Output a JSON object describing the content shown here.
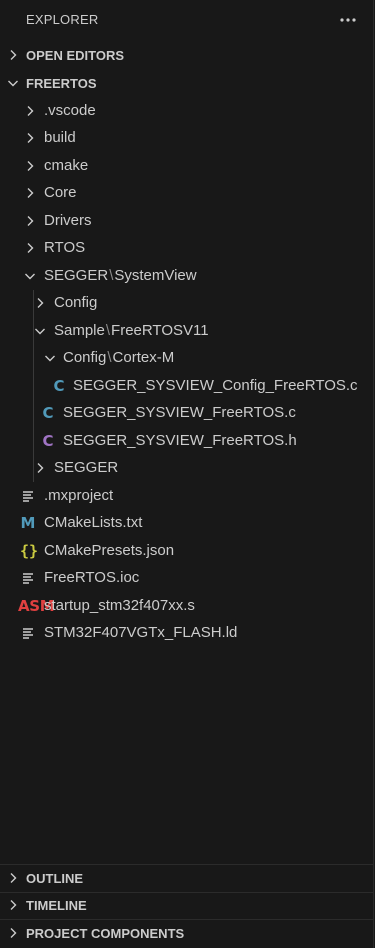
{
  "explorer": {
    "title": "EXPLORER",
    "more_label": "Views and More Actions"
  },
  "sections": {
    "open_editors": "OPEN EDITORS",
    "folder": "FREERTOS",
    "outline": "OUTLINE",
    "timeline": "TIMELINE",
    "project_components": "PROJECT COMPONENTS"
  },
  "tree": {
    "vscode": ".vscode",
    "build": "build",
    "cmake": "cmake",
    "core": "Core",
    "drivers": "Drivers",
    "rtos": "RTOS",
    "segger": "SEGGER",
    "systemview": "SystemView",
    "config": "Config",
    "sample": "Sample",
    "freertosv11": "FreeRTOSV11",
    "config2": "Config",
    "cortex_m": "Cortex-M",
    "sysview_config_c": "SEGGER_SYSVIEW_Config_FreeRTOS.c",
    "sysview_freertos_c": "SEGGER_SYSVIEW_FreeRTOS.c",
    "sysview_freertos_h": "SEGGER_SYSVIEW_FreeRTOS.h",
    "segger_sub": "SEGGER",
    "mxproject": ".mxproject",
    "cmakelists": "CMakeLists.txt",
    "cmakepresets": "CMakePresets.json",
    "freertos_ioc": "FreeRTOS.ioc",
    "startup_s": "startup_stm32f407xx.s",
    "flash_ld": "STM32F407VGTx_FLASH.ld"
  },
  "glyphs": {
    "path_separator": "\\",
    "c_file": "C",
    "h_file": "C",
    "cmake_file": "M",
    "json_file": "{}",
    "asm_file": "ASM"
  },
  "icons": {
    "folder_collapsed": "chevron-right-icon",
    "folder_expanded": "chevron-down-icon",
    "plain_file": "lines-file-icon"
  },
  "colors": {
    "background": "#181818",
    "text": "#cccccc",
    "c_file": "#519aba",
    "h_file": "#a074c4",
    "cmake_file": "#519aba",
    "json_file": "#cbcb41",
    "asm_file": "#e04040"
  }
}
